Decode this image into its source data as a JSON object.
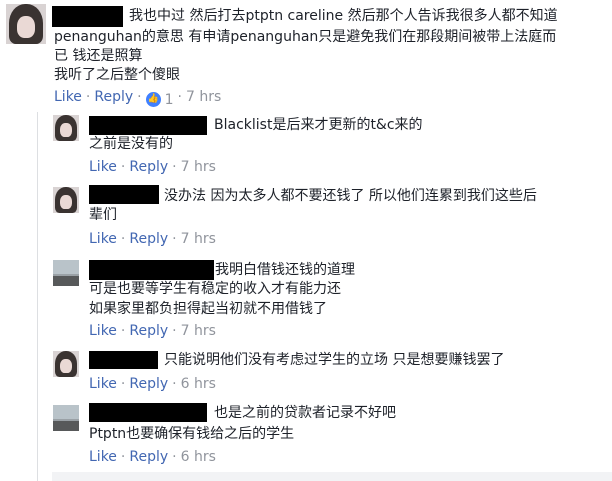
{
  "main_comment": {
    "lines": [
      "我也中过 然后打去ptptn careline 然后那个人告诉我很多人都不知道",
      "penanguhan的意思 有申请penanguhan只是避免我们在那段期间被带上法庭而",
      "已 钱还是照算",
      "我听了之后整个傻眼"
    ],
    "like_label": "Like",
    "reply_label": "Reply",
    "like_count": "1",
    "time": "7 hrs"
  },
  "replies": [
    {
      "lines": [
        "Blacklist是后来才更新的t&c来的",
        "之前是没有的"
      ],
      "like_label": "Like",
      "reply_label": "Reply",
      "time": "7 hrs"
    },
    {
      "lines": [
        "没办法 因为太多人都不要还钱了 所以他们连累到我们这些后",
        "辈们"
      ],
      "like_label": "Like",
      "reply_label": "Reply",
      "time": "7 hrs"
    },
    {
      "lines": [
        "我明白借钱还钱的道理",
        "可是也要等学生有稳定的收入才有能力还",
        "如果家里都负担得起当初就不用借钱了"
      ],
      "like_label": "Like",
      "reply_label": "Reply",
      "time": "7 hrs"
    },
    {
      "lines": [
        "只能说明他们没有考虑过学生的立场 只是想要赚钱罢了"
      ],
      "like_label": "Like",
      "reply_label": "Reply",
      "time": "6 hrs"
    },
    {
      "lines": [
        "也是之前的贷款者记录不好吧",
        "Ptptn也要确保有钱给之后的学生"
      ],
      "like_label": "Like",
      "reply_label": "Reply",
      "time": "6 hrs"
    }
  ],
  "colors": {
    "link": "#4267b2",
    "meta": "#90949c",
    "like_badge": "#4080ff"
  },
  "icons": {
    "like_badge": "thumbs-up-icon"
  }
}
